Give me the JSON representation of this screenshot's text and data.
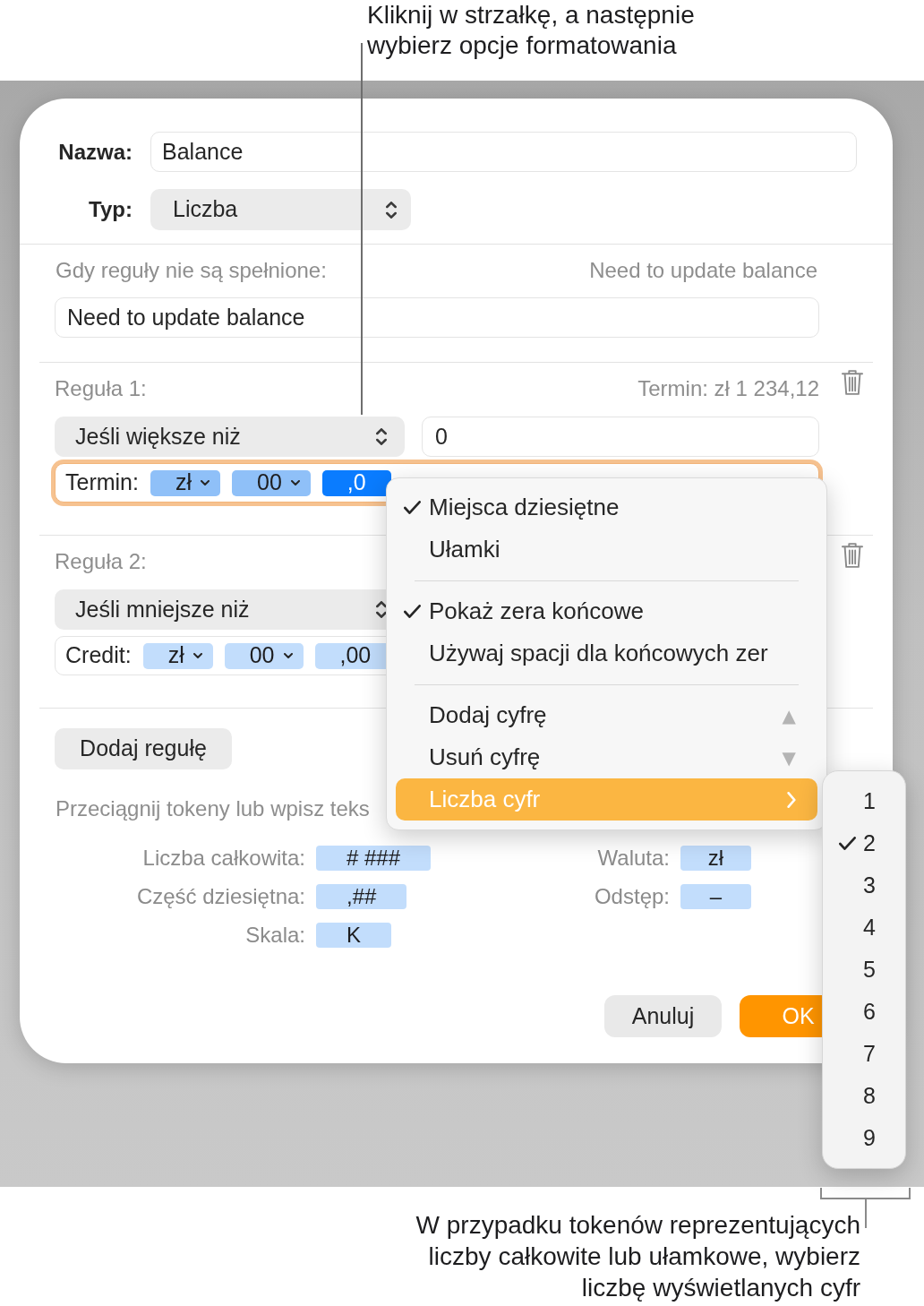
{
  "callout_top": "Kliknij w strzałkę, a następnie\nwybierz opcje formatowania",
  "dialog": {
    "name_field": {
      "label": "Nazwa:",
      "value": "Balance"
    },
    "type_field": {
      "label": "Typ:",
      "value": "Liczba"
    },
    "fallback": {
      "label": "Gdy reguły nie są spełnione:",
      "preview": "Need to update balance",
      "value": "Need to update balance"
    },
    "rules": [
      {
        "label": "Reguła 1:",
        "preview": "Termin: zł 1 234,12",
        "condition": "Jeśli większe niż",
        "value": "0",
        "format": {
          "label": "Termin:",
          "focused": true,
          "tokens": [
            {
              "text": "zł",
              "kind": "dropdown",
              "selected": false
            },
            {
              "text": "00",
              "kind": "dropdown",
              "selected": false
            },
            {
              "text": ",0",
              "kind": "plain",
              "selected": true
            }
          ]
        }
      },
      {
        "label": "Reguła 2:",
        "condition": "Jeśli mniejsze niż",
        "format": {
          "label": "Credit:",
          "focused": false,
          "tokens": [
            {
              "text": "zł",
              "kind": "dropdown",
              "selected": false
            },
            {
              "text": "00",
              "kind": "dropdown",
              "selected": false
            },
            {
              "text": ",00",
              "kind": "plain",
              "selected": false
            }
          ]
        }
      }
    ],
    "add_rule_button": "Dodaj regułę",
    "hint": "Przeciągnij tokeny lub wpisz teks",
    "token_legend": [
      [
        {
          "label": "Liczba całkowita:",
          "token": "# ###"
        },
        {
          "label": "Część dziesiętna:",
          "token": ",##"
        },
        {
          "label": "Skala:",
          "token": "K"
        }
      ],
      [
        {
          "label": "Waluta:",
          "token": "zł"
        },
        {
          "label": "Odstęp:",
          "token": "–"
        }
      ]
    ],
    "buttons": [
      {
        "label": "Anuluj",
        "kind": "secondary"
      },
      {
        "label": "OK",
        "kind": "primary"
      }
    ]
  },
  "format_menu": {
    "groups": [
      [
        {
          "label": "Miejsca dziesiętne",
          "kind": "option",
          "checked": true,
          "selected": false
        },
        {
          "label": "Ułamki",
          "kind": "option",
          "checked": false,
          "selected": false
        }
      ],
      [
        {
          "label": "Pokaż zera końcowe",
          "kind": "option",
          "checked": true,
          "selected": false
        },
        {
          "label": "Używaj spacji dla końcowych zer",
          "kind": "option",
          "checked": false,
          "selected": false
        }
      ],
      [
        {
          "label": "Dodaj cyfrę",
          "kind": "option",
          "checked": false,
          "selected": false,
          "shortcut": "▲"
        },
        {
          "label": "Usuń cyfrę",
          "kind": "option",
          "checked": false,
          "selected": false,
          "shortcut": "▼"
        },
        {
          "label": "Liczba cyfr",
          "kind": "submenu",
          "checked": false,
          "selected": true
        }
      ]
    ]
  },
  "digits_submenu": {
    "items": [
      {
        "label": "1",
        "checked": false
      },
      {
        "label": "2",
        "checked": true
      },
      {
        "label": "3",
        "checked": false
      },
      {
        "label": "4",
        "checked": false
      },
      {
        "label": "5",
        "checked": false
      },
      {
        "label": "6",
        "checked": false
      },
      {
        "label": "7",
        "checked": false
      },
      {
        "label": "8",
        "checked": false
      },
      {
        "label": "9",
        "checked": false
      }
    ]
  },
  "callout_bottom": "W przypadku tokenów reprezentujących\nliczby całkowite lub ułamkowe, wybierz\nliczbę wyświetlanych cyfr"
}
